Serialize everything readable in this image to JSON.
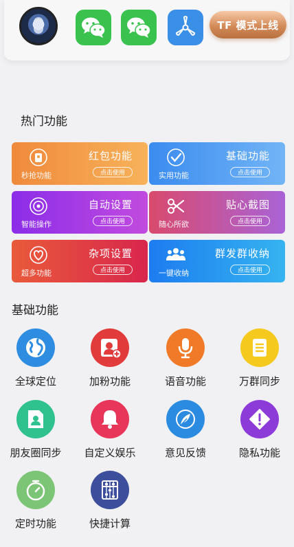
{
  "header": {
    "mode_button": "TF 模式上线",
    "apps": [
      "wechat-icon",
      "wechat-icon",
      "fan-icon"
    ]
  },
  "hot_section": {
    "title": "热门功能",
    "cards": [
      {
        "title": "红包功能",
        "subtitle": "秒抢功能",
        "button": "点击使用",
        "icon": "red-packet-icon",
        "color": "#f39a43"
      },
      {
        "title": "基础功能",
        "subtitle": "实用功能",
        "button": "点击使用",
        "icon": "check-badge-icon",
        "color": "#4d98f2"
      },
      {
        "title": "自动设置",
        "subtitle": "智能操作",
        "button": "点击使用",
        "icon": "target-icon",
        "color": "#a53ee4"
      },
      {
        "title": "贴心截图",
        "subtitle": "随心所欲",
        "button": "点击使用",
        "icon": "scissors-icon",
        "color": "#c85596"
      },
      {
        "title": "杂项设置",
        "subtitle": "超多功能",
        "button": "点击使用",
        "icon": "heart-badge-icon",
        "color": "#e2403f"
      },
      {
        "title": "群发群收纳",
        "subtitle": "一键收纳",
        "button": "点击使用",
        "icon": "group-icon",
        "color": "#2591f0"
      }
    ]
  },
  "basic_section": {
    "title": "基础功能",
    "tools": [
      {
        "label": "全球定位",
        "icon": "globe-icon",
        "color": "#2e8de0"
      },
      {
        "label": "加粉功能",
        "icon": "add-user-icon",
        "color": "#e23b3b"
      },
      {
        "label": "语音功能",
        "icon": "microphone-icon",
        "color": "#f07a27"
      },
      {
        "label": "万群同步",
        "icon": "document-icon",
        "color": "#f5c91e"
      },
      {
        "label": "朋友圈同步",
        "icon": "contact-card-icon",
        "color": "#2fc28e"
      },
      {
        "label": "自定义娱乐",
        "icon": "bell-icon",
        "color": "#e8365a"
      },
      {
        "label": "意见反馈",
        "icon": "feather-icon",
        "color": "#2b8be0"
      },
      {
        "label": "隐私功能",
        "icon": "warning-icon",
        "color": "#8d3bd8"
      },
      {
        "label": "定时功能",
        "icon": "stopwatch-icon",
        "color": "#7cc576"
      },
      {
        "label": "快捷计算",
        "icon": "abacus-icon",
        "color": "#3d4f9c"
      }
    ]
  }
}
